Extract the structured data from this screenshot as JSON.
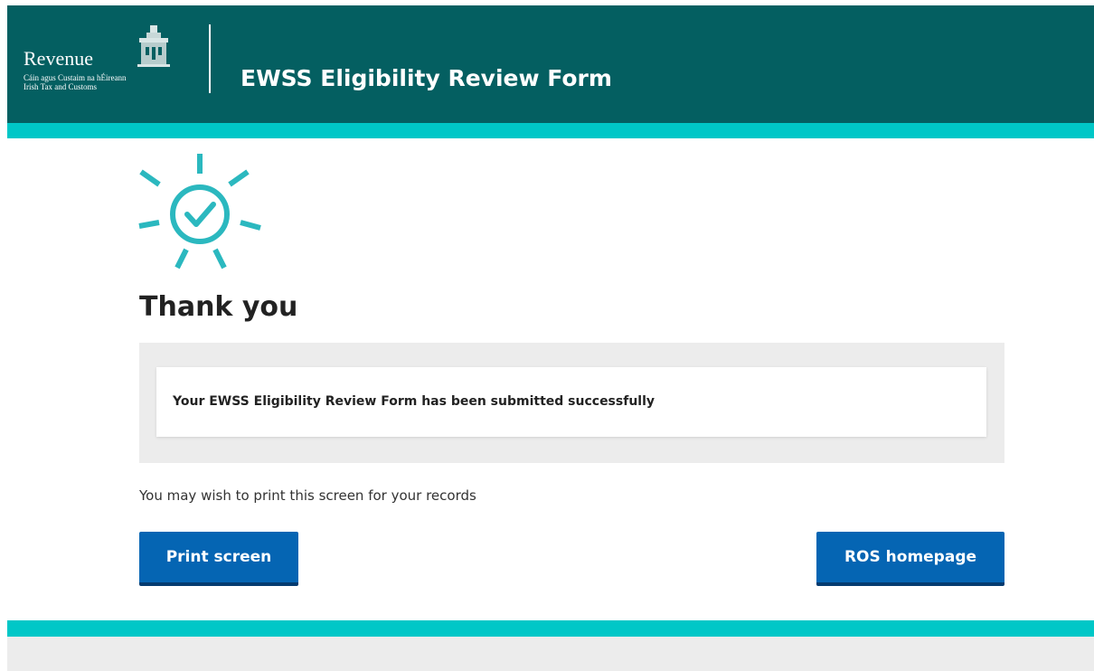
{
  "header": {
    "logo": {
      "name": "Revenue",
      "line1": "Cáin agus Custaim na hÉireann",
      "line2": "Irish Tax and Customs"
    },
    "title": "EWSS Eligibility Review Form"
  },
  "main": {
    "heading": "Thank you",
    "confirmation_message": "Your EWSS Eligibility Review Form has been submitted successfully",
    "hint": "You may wish to print this screen for your records",
    "buttons": {
      "print_label": "Print screen",
      "home_label": "ROS homepage"
    }
  },
  "icons": {
    "success": "sun-check-icon",
    "logo_building": "custom-house-icon"
  },
  "colors": {
    "header_bg": "#045f61",
    "accent_stripe": "#00c7c7",
    "button_bg": "#0565b3",
    "icon_color": "#2bb8bf"
  }
}
